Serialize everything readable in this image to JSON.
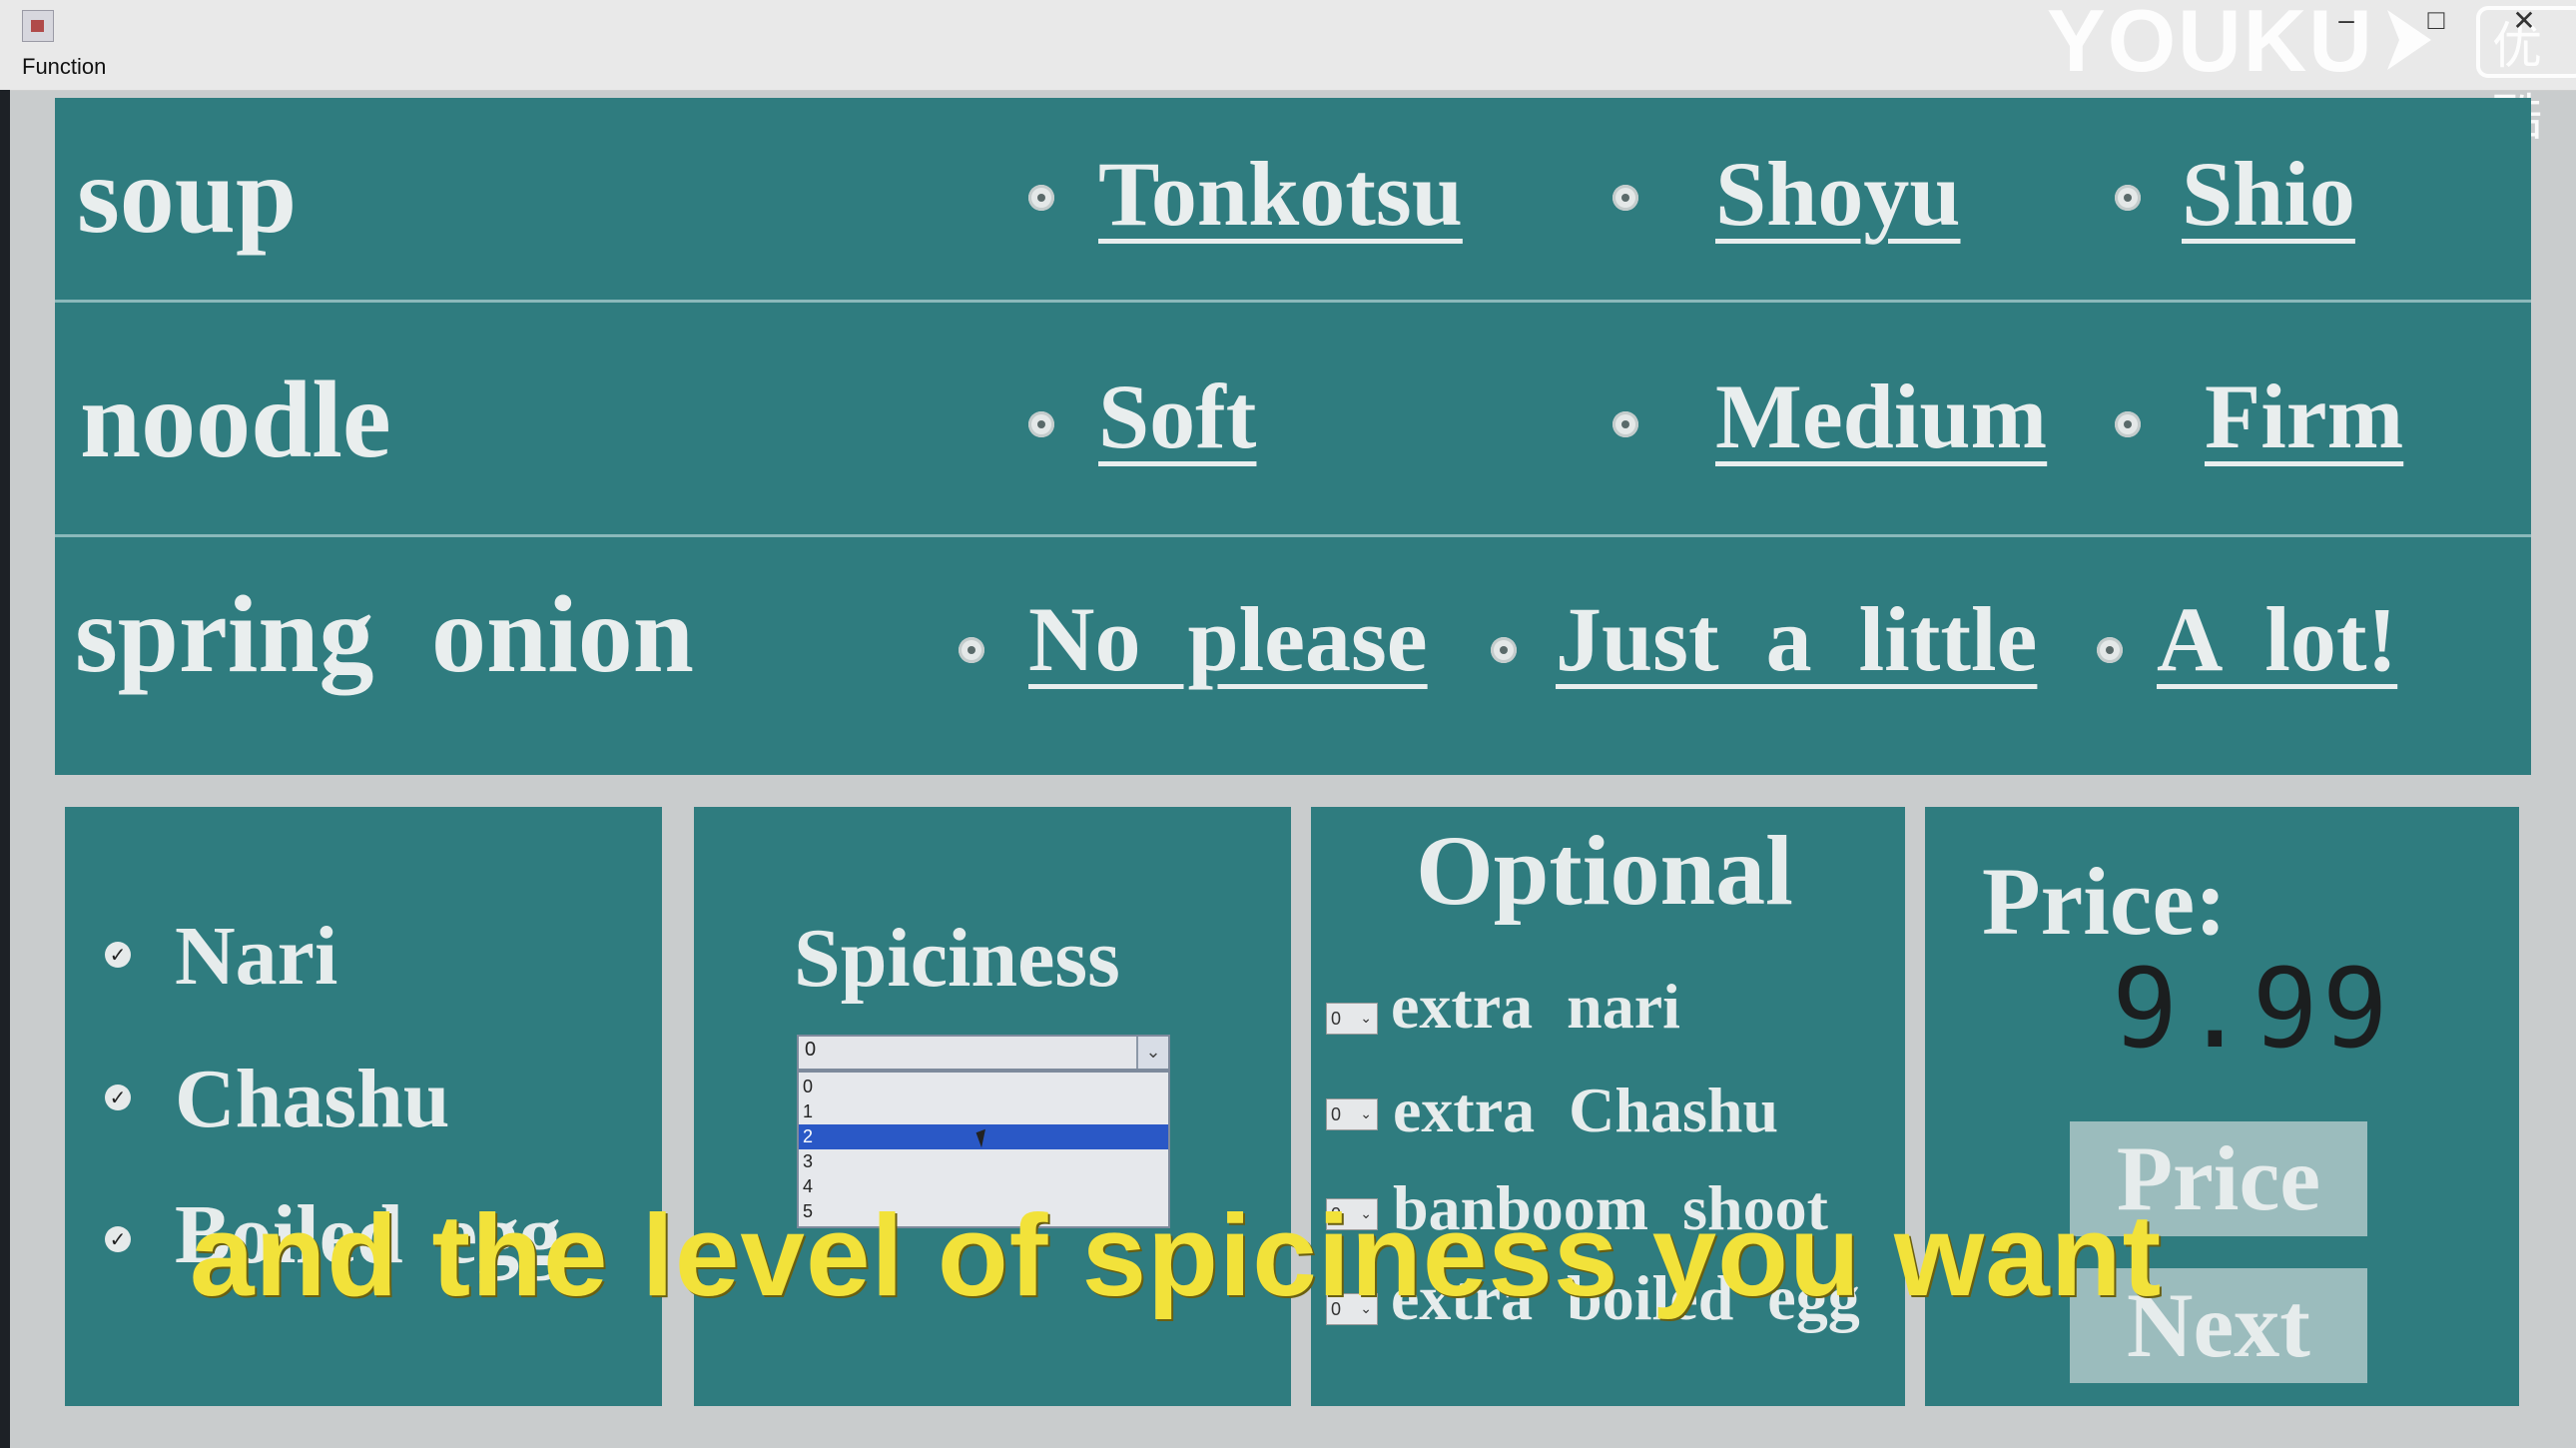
{
  "window": {
    "title": "Function",
    "watermark": "YOUKU",
    "watermark_cn": "优酷"
  },
  "soup": {
    "label": "soup",
    "options": [
      "Tonkotsu",
      "Shoyu",
      "Shio"
    ]
  },
  "noodle": {
    "label": "noodle",
    "options": [
      "Soft",
      "Medium",
      "Firm"
    ]
  },
  "spring_onion": {
    "label": "spring onion",
    "options": [
      "No please",
      "Just a little",
      "A lot!"
    ]
  },
  "toppings": {
    "items": [
      "Nari",
      "Chashu",
      "Boiled egg"
    ]
  },
  "spiciness": {
    "title": "Spiciness",
    "selected": "0",
    "options": [
      "0",
      "1",
      "2",
      "3",
      "4",
      "5"
    ],
    "highlighted": "2"
  },
  "optional": {
    "title": "Optional",
    "items": [
      {
        "qty": "0",
        "label": "extra nari"
      },
      {
        "qty": "0",
        "label": "extra Chashu"
      },
      {
        "qty": "0",
        "label": "banboom shoot"
      },
      {
        "qty": "0",
        "label": "extra boiled egg"
      }
    ]
  },
  "price": {
    "label": "Price:",
    "value": "9.99",
    "price_button": "Price",
    "next_button": "Next"
  },
  "subtitle": "and the level of spiciness you want",
  "colors": {
    "panel": "#2f7c7f",
    "subtitle": "#f2e23a",
    "highlight": "#2a58c6"
  },
  "icons": [
    "app-icon",
    "minimize-icon",
    "maximize-icon",
    "close-icon",
    "chevron-down-icon",
    "radio-icon",
    "checkbox-icon",
    "mouse-cursor-icon"
  ]
}
